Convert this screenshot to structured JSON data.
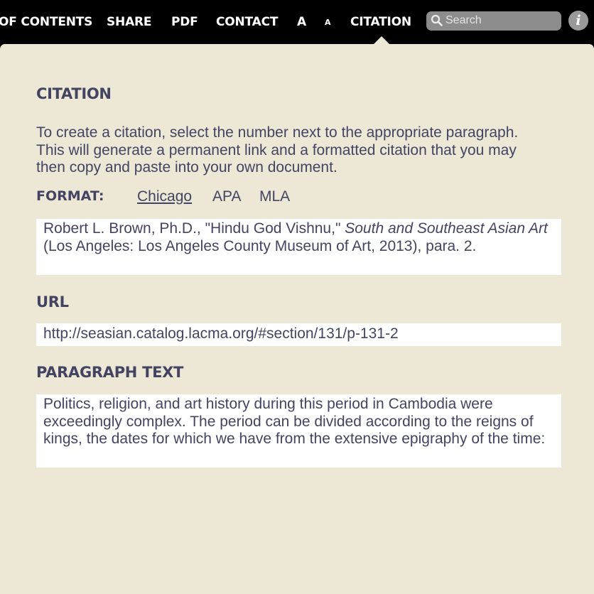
{
  "nav": {
    "items": [
      "OF CONTENTS",
      "SHARE",
      "PDF",
      "CONTACT",
      "A",
      "A",
      "CITATION"
    ],
    "search_placeholder": "Search",
    "info_label": "i"
  },
  "citation": {
    "title": "CITATION",
    "intro": "To create a citation, select the number next to the appropriate paragraph. This will generate a permanent link and a formatted citation that you may then copy and paste into your own document.",
    "format_label": "FORMAT:",
    "formats": [
      "Chicago",
      "APA",
      "MLA"
    ],
    "selected_format": "Chicago",
    "citation_text": {
      "before": "Robert L. Brown, Ph.D., \"Hindu God Vishnu,\" ",
      "title_italic": "South and Southeast Asian Art",
      "after": " (Los Angeles: Los Angeles County Museum of Art, 2013), para. 2."
    },
    "url_label": "URL",
    "url": "http://seasian.catalog.lacma.org/#section/131/p-131-2",
    "paragraph_label": "PARAGRAPH TEXT",
    "paragraph_text": "Politics, religion, and art history during this period in Cambodia were exceedingly complex. The period can be divided according to the reigns of kings, the dates for which we have from the extensive epigraphy of the time:"
  }
}
